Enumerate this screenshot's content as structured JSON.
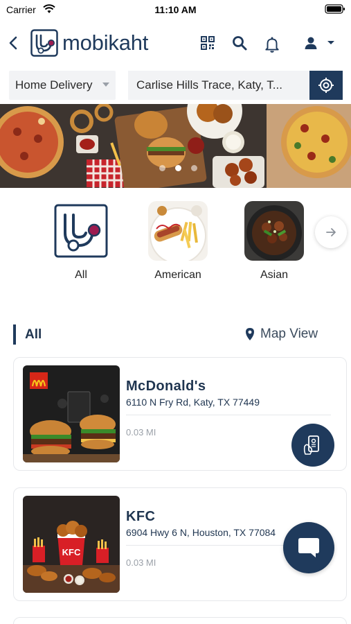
{
  "status_bar": {
    "carrier": "Carrier",
    "time": "11:10 AM"
  },
  "header": {
    "logo_text": "mobikaht",
    "icons": [
      "back-icon",
      "qr-code-icon",
      "search-icon",
      "bell-icon",
      "user-icon",
      "chevron-down-icon"
    ]
  },
  "delivery": {
    "selected": "Home Delivery"
  },
  "address": {
    "value": "Carlise Hills Trace, Katy, T..."
  },
  "banner": {
    "dots": 3,
    "active_dot": 2
  },
  "categories": {
    "items": [
      {
        "label": "All"
      },
      {
        "label": "American"
      },
      {
        "label": "Asian"
      }
    ]
  },
  "section": {
    "title": "All",
    "map_view_label": "Map View"
  },
  "restaurants": [
    {
      "name": "McDonald's",
      "address": "6110 N Fry Rd, Katy, TX 77449",
      "distance": "0.03 MI"
    },
    {
      "name": "KFC",
      "address": "6904 Hwy 6 N, Houston, TX 77084",
      "distance": "0.03 MI"
    }
  ],
  "colors": {
    "primary": "#1f3a5c",
    "text": "#1f3550",
    "muted": "#9aa0a8",
    "field_bg": "#f2f3f5"
  }
}
